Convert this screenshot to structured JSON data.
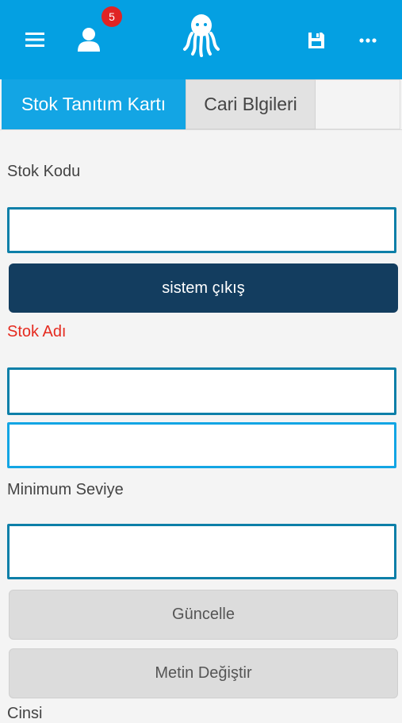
{
  "header": {
    "notification_count": "5",
    "icons": [
      "menu-icon",
      "user-icon",
      "octopus-logo-icon",
      "save-icon",
      "more-icon"
    ],
    "accent_color": "#04a0e2"
  },
  "tabs": [
    {
      "label": "Stok Tanıtım Kartı",
      "active": true
    },
    {
      "label": "Cari Blgileri",
      "active": false
    }
  ],
  "form": {
    "stok_kodu_label": "Stok Kodu",
    "stok_kodu_value": "",
    "sistem_cikis_button": "sistem çıkış",
    "stok_adi_label": "Stok Adı",
    "stok_adi_value_1": "",
    "stok_adi_value_2": "",
    "minimum_seviye_label": "Minimum Seviye",
    "minimum_seviye_value": "",
    "guncelle_button": "Güncelle",
    "metin_degistir_button": "Metin Değiştir",
    "cinsi_label": "Cinsi"
  }
}
